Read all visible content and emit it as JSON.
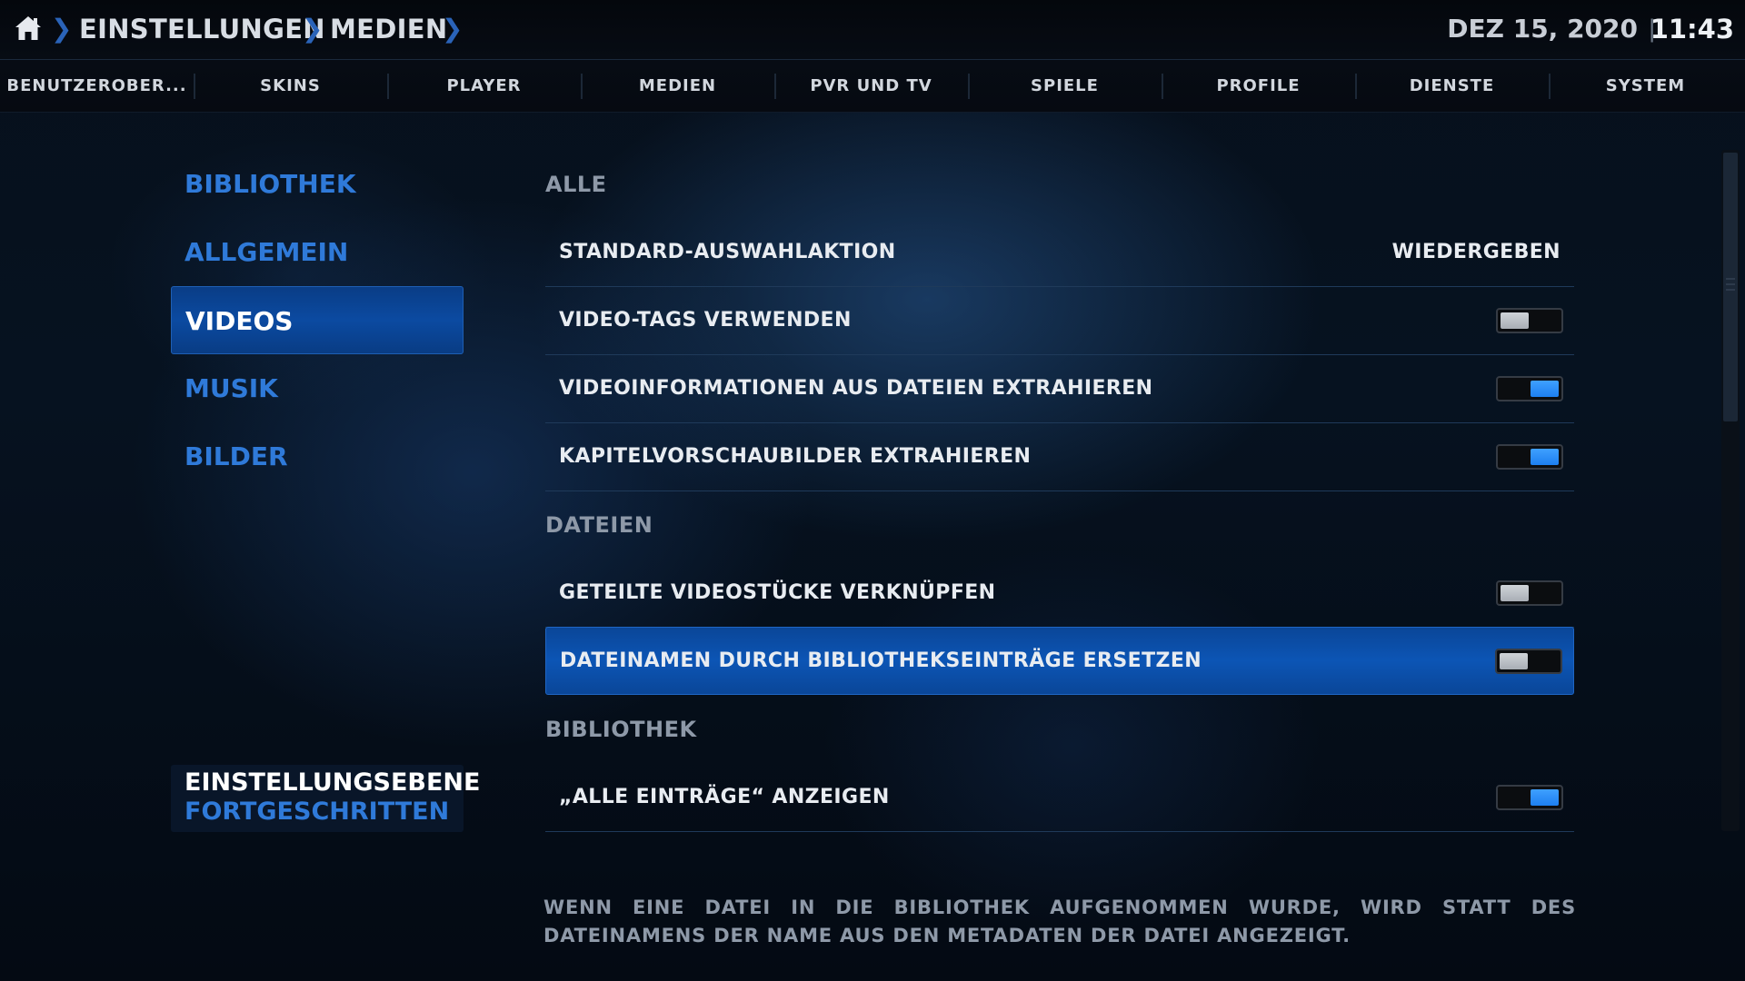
{
  "header": {
    "home_icon": "home-icon",
    "breadcrumbs": [
      "EINSTELLUNGEN",
      "MEDIEN"
    ],
    "date": "DEZ 15, 2020",
    "separator": "|",
    "time": "11:43",
    "accent_color": "#2a63b8"
  },
  "tabs": [
    {
      "label": "BENUTZEROBER..."
    },
    {
      "label": "SKINS"
    },
    {
      "label": "PLAYER"
    },
    {
      "label": "MEDIEN"
    },
    {
      "label": "PVR UND TV"
    },
    {
      "label": "SPIELE"
    },
    {
      "label": "PROFILE"
    },
    {
      "label": "DIENSTE"
    },
    {
      "label": "SYSTEM"
    }
  ],
  "sidebar": {
    "items": [
      {
        "label": "BIBLIOTHEK"
      },
      {
        "label": "ALLGEMEIN"
      },
      {
        "label": "VIDEOS",
        "active": true
      },
      {
        "label": "MUSIK"
      },
      {
        "label": "BILDER"
      }
    ],
    "settings_level": {
      "title": "EINSTELLUNGSEBENE",
      "value": "FORTGESCHRITTEN"
    }
  },
  "sections": [
    {
      "title": "ALLE",
      "rows": [
        {
          "label": "STANDARD-AUSWAHLAKTION",
          "value": "WIEDERGEBEN"
        },
        {
          "label": "VIDEO-TAGS VERWENDEN",
          "toggle": false
        },
        {
          "label": "VIDEOINFORMATIONEN AUS DATEIEN EXTRAHIEREN",
          "toggle": true
        },
        {
          "label": "KAPITELVORSCHAUBILDER EXTRAHIEREN",
          "toggle": true
        }
      ]
    },
    {
      "title": "DATEIEN",
      "rows": [
        {
          "label": "GETEILTE VIDEOSTÜCKE VERKNÜPFEN",
          "toggle": false
        },
        {
          "label": "DATEINAMEN DURCH BIBLIOTHEKSEINTRÄGE ERSETZEN",
          "toggle": false,
          "selected": true
        }
      ]
    },
    {
      "title": "BIBLIOTHEK",
      "rows": [
        {
          "label": "„ALLE EINTRÄGE“ ANZEIGEN",
          "toggle": true
        }
      ]
    }
  ],
  "description": "WENN EINE DATEI IN DIE BIBLIOTHEK AUFGENOMMEN WURDE, WIRD STATT DES DATEINAMENS DER NAME AUS DEN METADATEN DER DATEI ANGEZEIGT.",
  "colors": {
    "toggle_on": "#2a8cff",
    "toggle_off": "#c0c4ca",
    "selection": "#0b4fa8",
    "menu_text": "#2f7ad9"
  }
}
